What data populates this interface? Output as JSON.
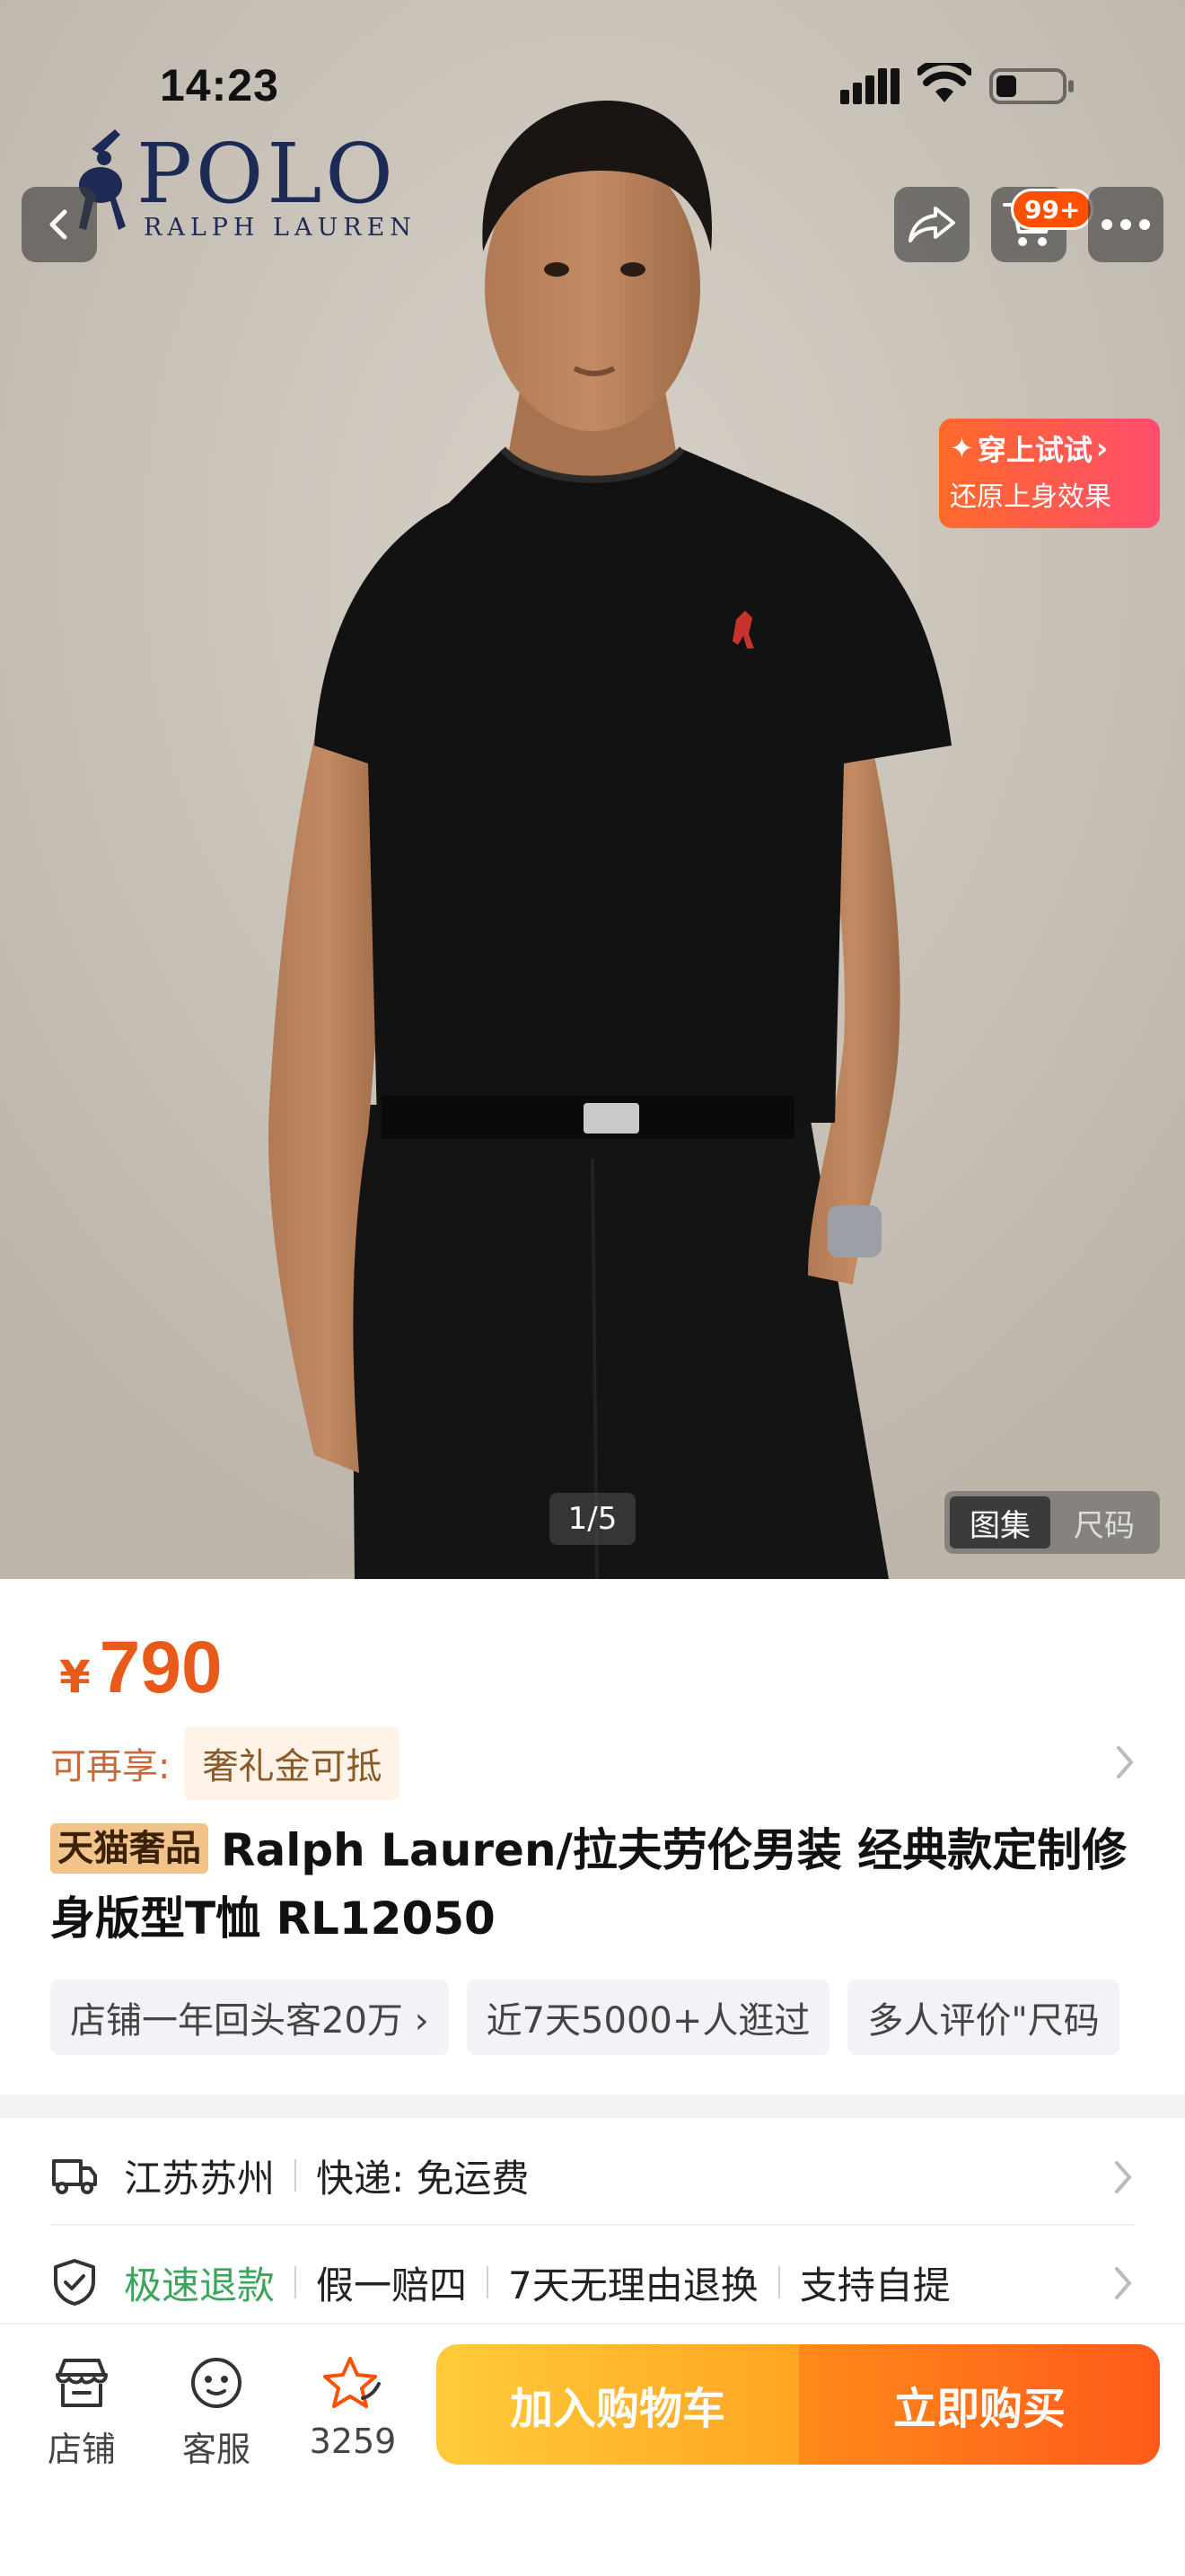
{
  "status_bar": {
    "time": "14:23"
  },
  "brand": {
    "line1": "POLO",
    "line2": "RALPH LAUREN"
  },
  "header": {
    "cart_badge": "99+"
  },
  "try_on": {
    "title": "穿上试试",
    "subtitle": "还原上身效果"
  },
  "gallery": {
    "counter": "1/5",
    "tabs": [
      {
        "label": "图集",
        "active": true
      },
      {
        "label": "尺码",
        "active": false
      }
    ]
  },
  "product": {
    "currency_symbol": "¥",
    "price": "790",
    "perk_label": "可再享:",
    "perk_chip": "奢礼金可抵",
    "title_tag": "天猫奢品",
    "title": "Ralph Lauren/拉夫劳伦男装 经典款定制修身版型T恤 RL12050",
    "chips": [
      "店铺一年回头客20万 ›",
      "近7天5000+人逛过",
      "多人评价\"尺码"
    ]
  },
  "services": {
    "shipping": {
      "origin": "江苏苏州",
      "delivery": "快递: 免运费"
    },
    "guarantees": [
      "极速退款",
      "假一赔四",
      "7天无理由退换",
      "支持自提"
    ]
  },
  "bottom_bar": {
    "store_label": "店铺",
    "service_label": "客服",
    "favorites_count": "3259",
    "add_to_cart": "加入购物车",
    "buy_now": "立即购买"
  },
  "colors": {
    "accent": "#ff5000",
    "price": "#e85a1a",
    "guarantee_green": "#3ba55c"
  }
}
